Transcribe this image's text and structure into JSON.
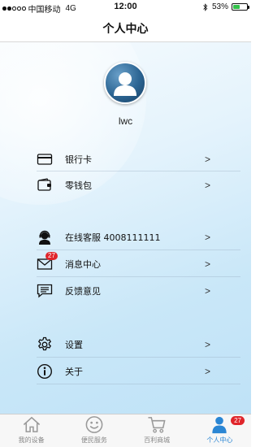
{
  "status_bar": {
    "carrier": "中国移动",
    "network": "4G",
    "time": "12:00",
    "battery_percent": "53%",
    "battery_level": 0.53,
    "signal_bars": 2
  },
  "nav": {
    "title": "个人中心"
  },
  "profile": {
    "username": "lwc"
  },
  "menu": {
    "items": [
      {
        "label": "银行卡",
        "chevron": ">",
        "icon": "card-icon"
      },
      {
        "label": "零钱包",
        "chevron": ">",
        "icon": "wallet-icon"
      },
      {
        "label": "在线客服 4008111111",
        "chevron": ">",
        "icon": "support-agent-icon"
      },
      {
        "label": "消息中心",
        "chevron": ">",
        "icon": "envelope-icon",
        "badge": "27"
      },
      {
        "label": "反馈意见",
        "chevron": ">",
        "icon": "feedback-icon"
      },
      {
        "label": "设置",
        "chevron": ">",
        "icon": "gear-icon"
      },
      {
        "label": "关于",
        "chevron": ">",
        "icon": "info-icon"
      }
    ]
  },
  "tabs": [
    {
      "label": "我的设备",
      "icon": "home-icon",
      "active": false
    },
    {
      "label": "便民服务",
      "icon": "smiley-icon",
      "active": false
    },
    {
      "label": "百利商城",
      "icon": "cart-icon",
      "active": false
    },
    {
      "label": "个人中心",
      "icon": "person-icon",
      "active": true,
      "badge": "27"
    }
  ],
  "colors": {
    "accent": "#2a86d4",
    "badge": "#e0252b",
    "avatar": "#2c6593"
  }
}
